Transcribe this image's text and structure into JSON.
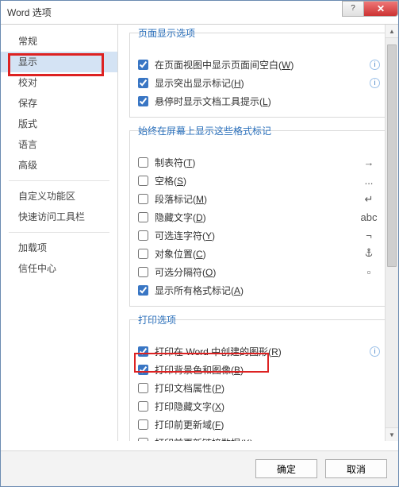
{
  "title": "Word 选项",
  "sidebar": {
    "items": [
      {
        "label": "常规"
      },
      {
        "label": "显示"
      },
      {
        "label": "校对"
      },
      {
        "label": "保存"
      },
      {
        "label": "版式"
      },
      {
        "label": "语言"
      },
      {
        "label": "高级"
      },
      {
        "label": "自定义功能区"
      },
      {
        "label": "快速访问工具栏"
      },
      {
        "label": "加载项"
      },
      {
        "label": "信任中心"
      }
    ],
    "selected_index": 1
  },
  "sections": {
    "page_display": {
      "legend": "页面显示选项",
      "items": [
        {
          "checked": true,
          "label_pre": "在页面视图中显示页面间空白(",
          "key": "W",
          "label_post": ")",
          "help": true
        },
        {
          "checked": true,
          "label_pre": "显示突出显示标记(",
          "key": "H",
          "label_post": ")",
          "help": true
        },
        {
          "checked": true,
          "label_pre": "悬停时显示文档工具提示(",
          "key": "L",
          "label_post": ")"
        }
      ]
    },
    "format_marks": {
      "legend": "始终在屏幕上显示这些格式标记",
      "items": [
        {
          "checked": false,
          "label_pre": "制表符(",
          "key": "T",
          "label_post": ")",
          "sym": "→"
        },
        {
          "checked": false,
          "label_pre": "空格(",
          "key": "S",
          "label_post": ")",
          "sym": "..."
        },
        {
          "checked": false,
          "label_pre": "段落标记(",
          "key": "M",
          "label_post": ")",
          "sym": "↵"
        },
        {
          "checked": false,
          "label_pre": "隐藏文字(",
          "key": "D",
          "label_post": ")",
          "sym": "abc"
        },
        {
          "checked": false,
          "label_pre": "可选连字符(",
          "key": "Y",
          "label_post": ")",
          "sym": "¬"
        },
        {
          "checked": false,
          "label_pre": "对象位置(",
          "key": "C",
          "label_post": ")",
          "sym": "anchor"
        },
        {
          "checked": false,
          "label_pre": "可选分隔符(",
          "key": "O",
          "label_post": ")",
          "sym": "▫"
        },
        {
          "checked": true,
          "label_pre": "显示所有格式标记(",
          "key": "A",
          "label_post": ")"
        }
      ]
    },
    "print": {
      "legend": "打印选项",
      "items": [
        {
          "checked": true,
          "label_pre": "打印在 Word 中创建的图形(",
          "key": "R",
          "label_post": ")",
          "help": true
        },
        {
          "checked": true,
          "label_pre": "打印背景色和图像(",
          "key": "B",
          "label_post": ")"
        },
        {
          "checked": false,
          "label_pre": "打印文档属性(",
          "key": "P",
          "label_post": ")"
        },
        {
          "checked": false,
          "label_pre": "打印隐藏文字(",
          "key": "X",
          "label_post": ")"
        },
        {
          "checked": false,
          "label_pre": "打印前更新域(",
          "key": "F",
          "label_post": ")"
        },
        {
          "checked": false,
          "label_pre": "打印前更新链接数据(",
          "key": "K",
          "label_post": ")"
        }
      ]
    }
  },
  "footer": {
    "ok": "确定",
    "cancel": "取消"
  }
}
